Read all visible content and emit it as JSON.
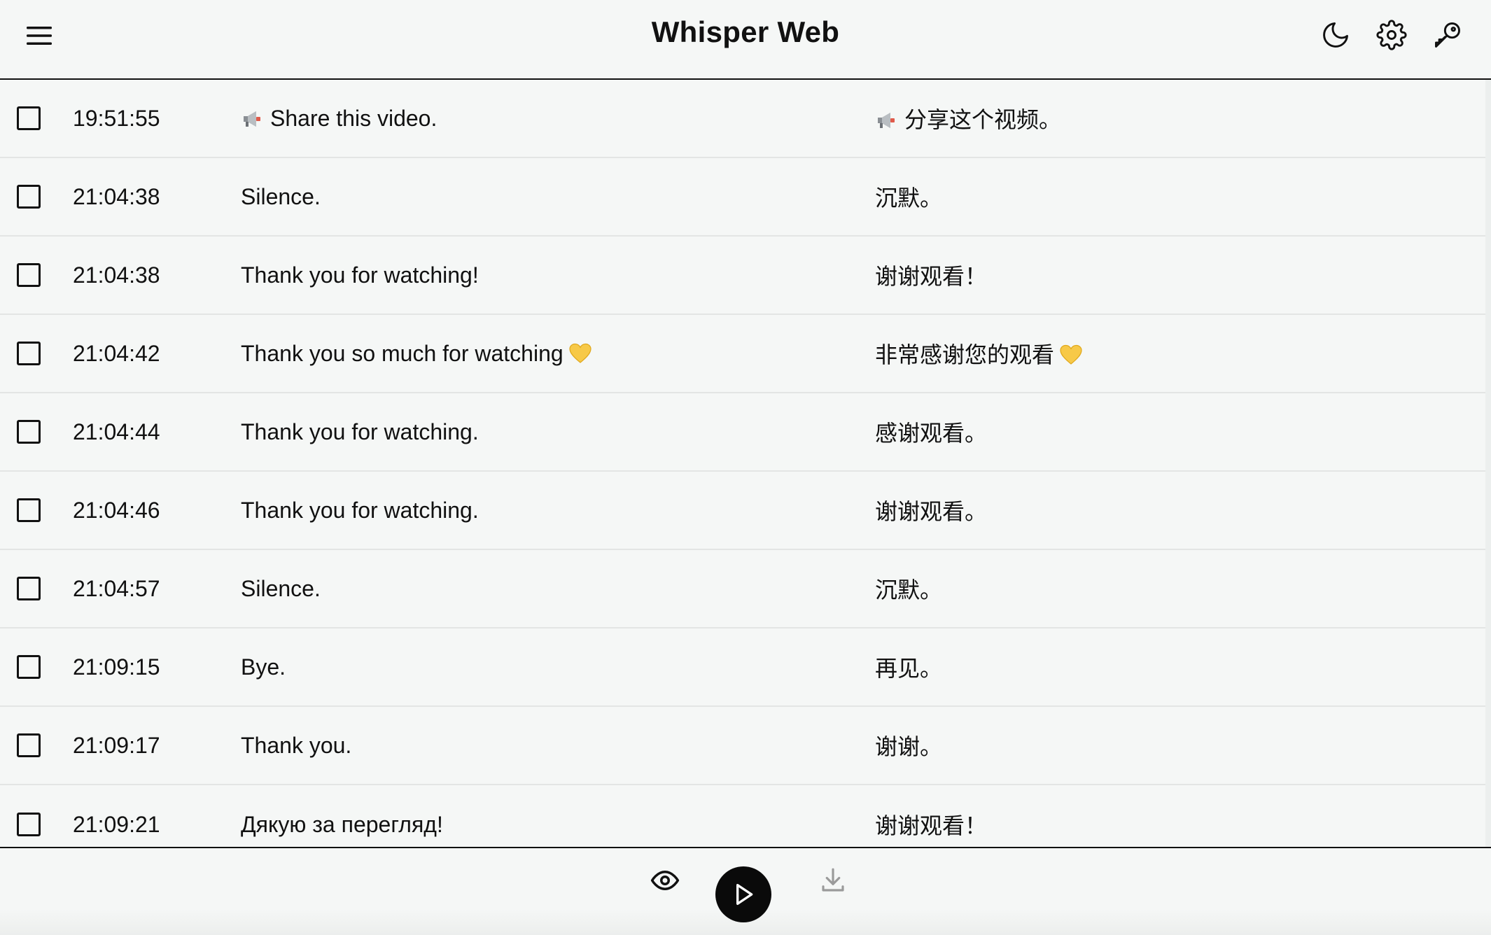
{
  "app": {
    "title": "Whisper Web"
  },
  "header": {
    "icons": [
      "menu-icon",
      "moon-icon",
      "gear-icon",
      "key-icon"
    ]
  },
  "rows": [
    {
      "time": "19:51:55",
      "original": "Share this video.",
      "translation": "分享这个视频。",
      "prefix_emoji": "megaphone",
      "checked": false
    },
    {
      "time": "21:04:38",
      "original": "Silence.",
      "translation": "沉默。",
      "checked": false
    },
    {
      "time": "21:04:38",
      "original": "Thank you for watching!",
      "translation": "谢谢观看！",
      "checked": false
    },
    {
      "time": "21:04:42",
      "original": "Thank you so much for watching",
      "translation": "非常感谢您的观看",
      "suffix_emoji": "yellow-heart",
      "checked": false
    },
    {
      "time": "21:04:44",
      "original": "Thank you for watching.",
      "translation": "感谢观看。",
      "checked": false
    },
    {
      "time": "21:04:46",
      "original": "Thank you for watching.",
      "translation": "谢谢观看。",
      "checked": false
    },
    {
      "time": "21:04:57",
      "original": "Silence.",
      "translation": "沉默。",
      "checked": false
    },
    {
      "time": "21:09:15",
      "original": "Bye.",
      "translation": "再见。",
      "checked": false
    },
    {
      "time": "21:09:17",
      "original": "Thank you.",
      "translation": "谢谢。",
      "checked": false
    },
    {
      "time": "21:09:21",
      "original": "Дякую за перегляд!",
      "translation": "谢谢观看！",
      "checked": false
    }
  ],
  "footer": {
    "icons": [
      "eye-icon",
      "play-icon",
      "download-icon"
    ],
    "download_enabled": false
  },
  "colors": {
    "background": "#f5f7f6",
    "text": "#111111",
    "play_button": "#0a0a0a",
    "divider": "#e3e5e4",
    "disabled_icon": "#9a9a9a"
  }
}
